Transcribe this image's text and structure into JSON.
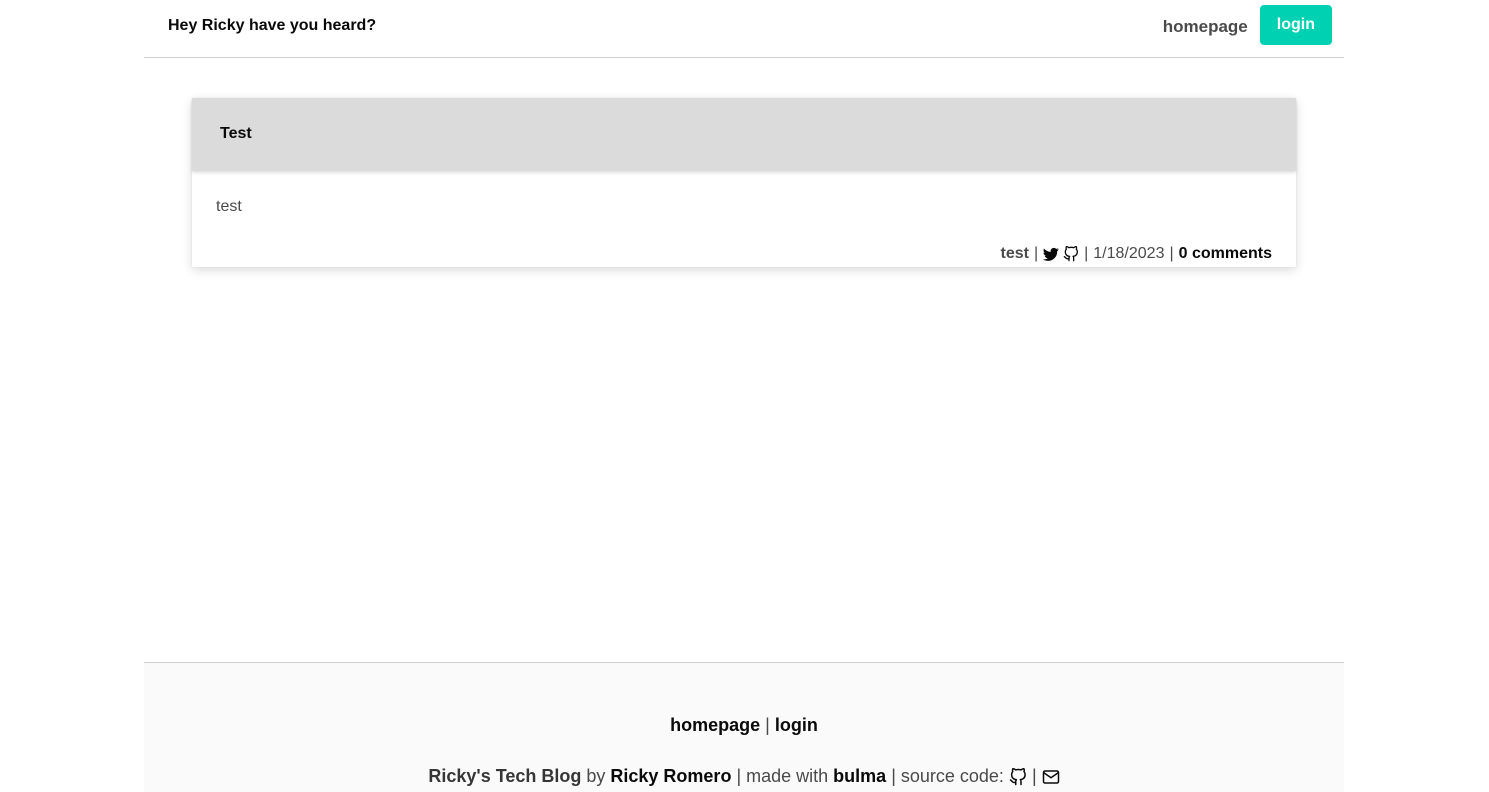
{
  "navbar": {
    "brand": "Hey Ricky have you heard?",
    "homepage_label": "homepage",
    "login_label": "login",
    "accent_color": "#00d1b2"
  },
  "post": {
    "title": "Test",
    "body": "test",
    "author": "test",
    "separator": "|",
    "date": "1/18/2023",
    "comments": "0 comments",
    "icons": [
      "twitter-icon",
      "github-icon"
    ]
  },
  "footer": {
    "homepage_label": "homepage",
    "separator": "|",
    "login_label": "login",
    "blog_name": "Ricky's Tech Blog",
    "by_text": "by",
    "author_name": "Ricky Romero",
    "made_with_text": "made with",
    "framework": "bulma",
    "source_code_text": "source code:",
    "icons": [
      "github-icon",
      "envelope-icon"
    ]
  }
}
